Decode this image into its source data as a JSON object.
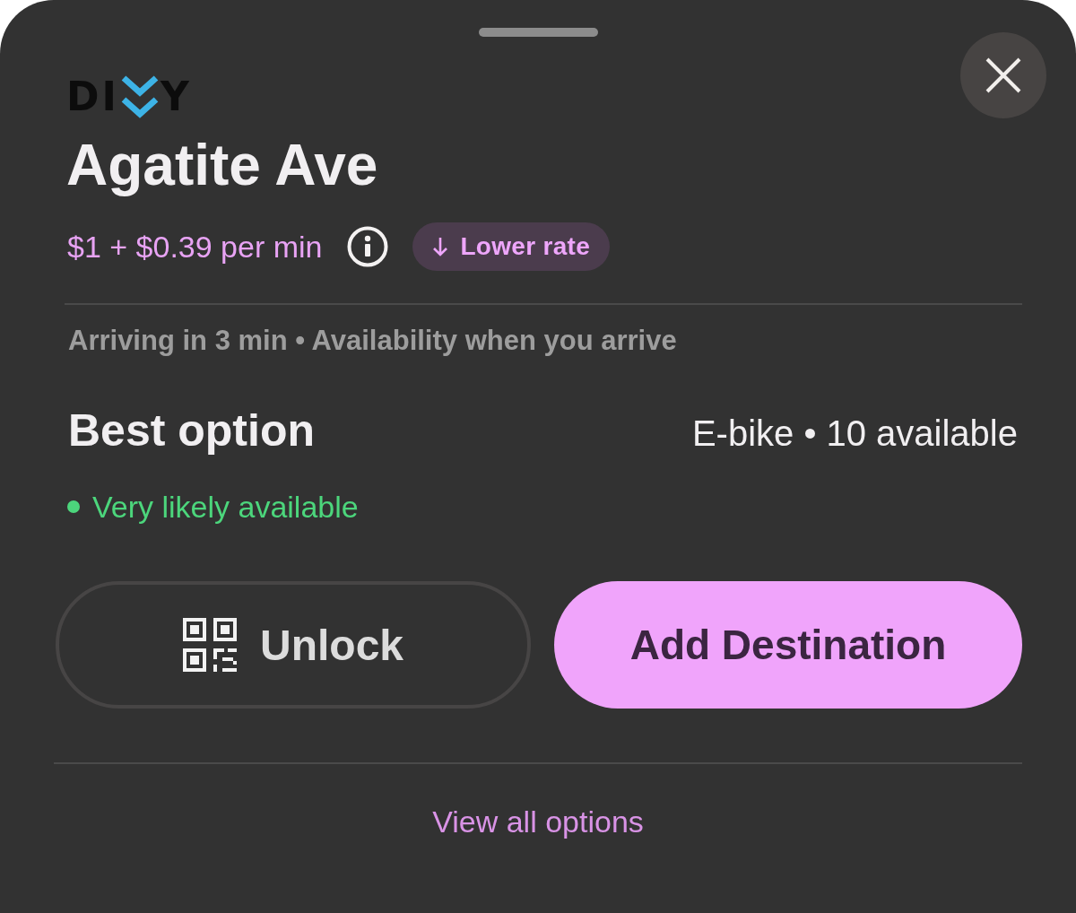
{
  "logo": {
    "lead": "DI",
    "tail": "Y"
  },
  "title": "Agatite Ave",
  "price": {
    "text": "$1 + $0.39 per min",
    "badge": "Lower rate"
  },
  "arrival": "Arriving in 3 min • Availability when you arrive",
  "best_option": {
    "heading": "Best option",
    "vehicle": "E-bike • 10 available",
    "likelihood": "Very likely available"
  },
  "actions": [
    {
      "kind": "scan",
      "label": "Unlock"
    },
    {
      "kind": "primary",
      "label": "Add Destination"
    }
  ],
  "footer_link": "View all options"
}
